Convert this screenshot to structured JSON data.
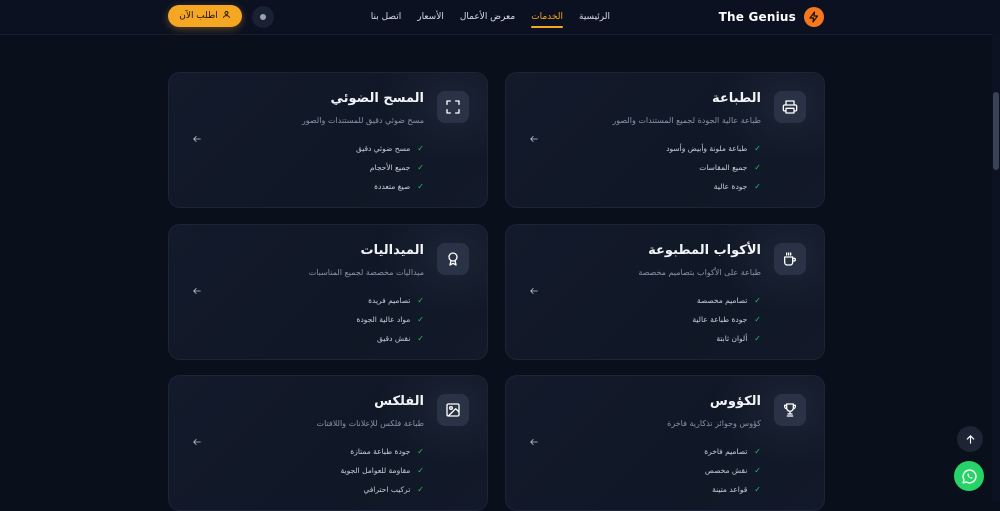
{
  "header": {
    "brand_name": "The Genius",
    "nav": [
      "الرئيسية",
      "الخدمات",
      "معرض الأعمال",
      "الأسعار",
      "اتصل بنا"
    ],
    "active_nav": "الخدمات",
    "order_label": "اطلب الآن"
  },
  "services": [
    {
      "title": "الطباعة",
      "subtitle": "طباعة عالية الجودة لجميع المستندات والصور",
      "icon": "printer-icon",
      "features": [
        "طباعة ملونة وأبيض وأسود",
        "جميع المقاسات",
        "جودة عالية"
      ]
    },
    {
      "title": "المسح الضوئي",
      "subtitle": "مسح ضوئي دقيق للمستندات والصور",
      "icon": "scan-icon",
      "features": [
        "مسح ضوئي دقيق",
        "جميع الأحجام",
        "صيغ متعددة"
      ]
    },
    {
      "title": "الأكواب المطبوعة",
      "subtitle": "طباعة على الأكواب بتصاميم مخصصة",
      "icon": "mug-icon",
      "features": [
        "تصاميم مخصصة",
        "جودة طباعة عالية",
        "ألوان ثابتة"
      ]
    },
    {
      "title": "الميداليات",
      "subtitle": "ميداليات مخصصة لجميع المناسبات",
      "icon": "medal-icon",
      "features": [
        "تصاميم فريدة",
        "مواد عالية الجودة",
        "نقش دقيق"
      ]
    },
    {
      "title": "الكؤوس",
      "subtitle": "كؤوس وجوائز تذكارية فاخرة",
      "icon": "trophy-icon",
      "features": [
        "تصاميم فاخرة",
        "نقش مخصص",
        "قواعد متينة"
      ]
    },
    {
      "title": "الفلكس",
      "subtitle": "طباعة فلكس للإعلانات واللافتات",
      "icon": "image-icon",
      "features": [
        "جودة طباعة ممتازة",
        "مقاومة للعوامل الجوية",
        "تركيب احترافي"
      ]
    }
  ],
  "colors": {
    "accent": "#f5a623",
    "brand_logo": "#f5781f",
    "check": "#22c55e",
    "whatsapp": "#25d366",
    "background": "#0a0f1c",
    "card": "#121928"
  }
}
